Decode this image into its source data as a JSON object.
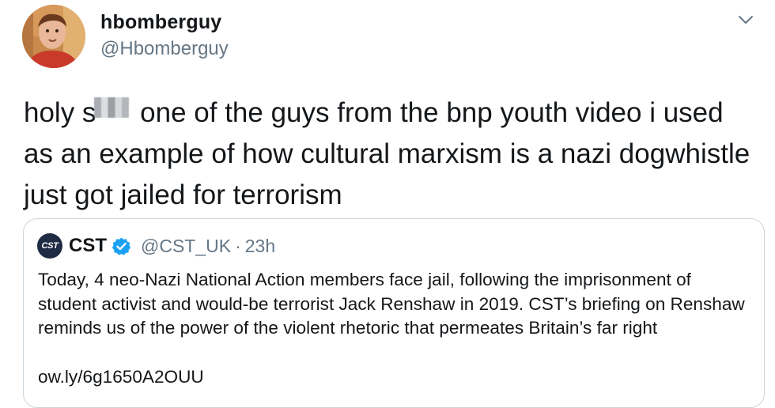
{
  "tweet": {
    "display_name": "hbomberguy",
    "handle": "@Hbomberguy",
    "text_before_censor": "holy s",
    "text_after_censor": " one of the guys from the bnp youth video i used as an example of how cultural marxism is a nazi dogwhistle just got jailed for terrorism",
    "menu_icon": "chevron-down-icon"
  },
  "quoted_tweet": {
    "logo_text": "CST",
    "display_name": "CST",
    "verified_icon": "verified-badge-icon",
    "handle": "@CST_UK",
    "separator": "·",
    "timestamp": "23h",
    "body": "Today, 4 neo-Nazi National Action members face jail, following the imprisonment of student activist and would-be terrorist Jack Renshaw in 2019. CST’s briefing on Renshaw reminds us of the power of the violent rhetoric that permeates Britain’s far right",
    "link": "ow.ly/6g1650A2OUU"
  },
  "colors": {
    "text_primary": "#14171a",
    "text_secondary": "#657786",
    "border": "#ccd6dd",
    "verified": "#1da1f2",
    "cst_logo_bg": "#1f2a44"
  }
}
